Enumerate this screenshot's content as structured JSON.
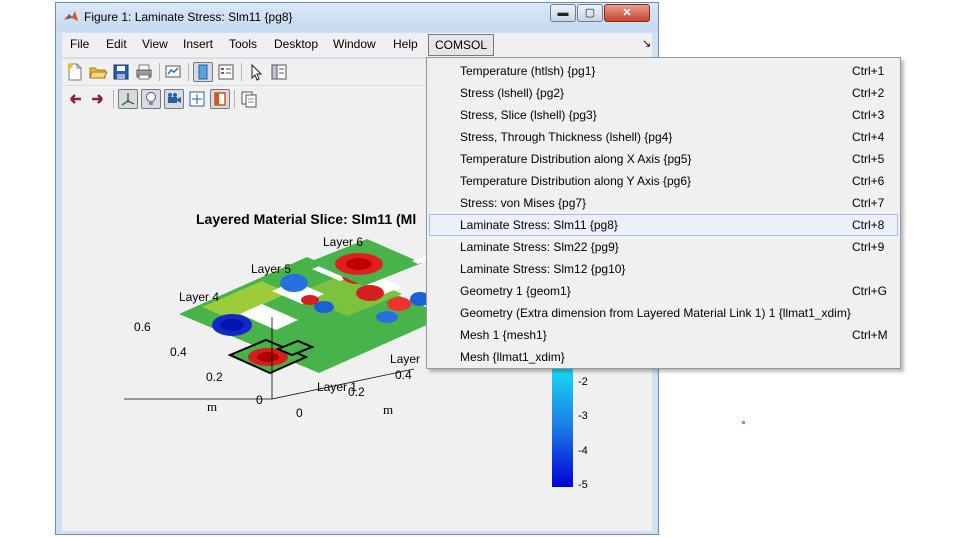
{
  "window": {
    "title": "Figure 1: Laminate Stress: Slm11 {pg8}",
    "controls": {
      "minimize": "▬",
      "maximize": "▢",
      "close": "✕"
    }
  },
  "menubar": {
    "items": [
      "File",
      "Edit",
      "View",
      "Insert",
      "Tools",
      "Desktop",
      "Window",
      "Help"
    ],
    "active": "COMSOL",
    "dock_icon": "↘"
  },
  "toolbar": {
    "row1_icons": [
      "new-figure-icon",
      "open-file-icon",
      "save-icon",
      "print-icon",
      "link-plot-icon",
      "dock-figure-icon",
      "insert-legend-icon",
      "pointer-icon",
      "property-editor-icon"
    ],
    "row2_icons": [
      "back-arrow-icon",
      "forward-arrow-icon",
      "axes-icon",
      "light-icon",
      "camera-icon",
      "zoom-fit-icon",
      "box-icon",
      "copy-icon"
    ]
  },
  "plot": {
    "title": "Layered Material Slice: Slm11 (Ml",
    "layer_labels": [
      "Layer 6",
      "Layer 5",
      "Layer 4",
      "Layer",
      "Layer 1"
    ],
    "y_ticks": [
      "0.6",
      "0.4",
      "0.2",
      "0"
    ],
    "x_ticks": [
      "0",
      "0.2",
      "0.4"
    ],
    "x_axis_label": "m",
    "y_axis_label": "m",
    "colorbar_ticks": [
      "-2",
      "-3",
      "-4",
      "-5"
    ]
  },
  "dropdown": {
    "items": [
      {
        "label": "Temperature (htlsh) {pg1}",
        "accel": "Ctrl+1"
      },
      {
        "label": "Stress (lshell) {pg2}",
        "accel": "Ctrl+2"
      },
      {
        "label": "Stress, Slice (lshell) {pg3}",
        "accel": "Ctrl+3"
      },
      {
        "label": "Stress, Through Thickness (lshell) {pg4}",
        "accel": "Ctrl+4"
      },
      {
        "label": "Temperature Distribution along X Axis {pg5}",
        "accel": "Ctrl+5"
      },
      {
        "label": "Temperature Distribution along Y Axis {pg6}",
        "accel": "Ctrl+6"
      },
      {
        "label": "Stress: von Mises {pg7}",
        "accel": "Ctrl+7"
      },
      {
        "label": "Laminate Stress: Slm11 {pg8}",
        "accel": "Ctrl+8"
      },
      {
        "label": "Laminate Stress: Slm22 {pg9}",
        "accel": "Ctrl+9"
      },
      {
        "label": "Laminate Stress: Slm12 {pg10}",
        "accel": ""
      },
      {
        "label": "Geometry 1 {geom1}",
        "accel": "Ctrl+G"
      },
      {
        "label": "Geometry (Extra dimension from Layered Material Link 1) 1 {llmat1_xdim}",
        "accel": ""
      },
      {
        "label": "Mesh 1 {mesh1}",
        "accel": "Ctrl+M"
      },
      {
        "label": "Mesh {llmat1_xdim}",
        "accel": ""
      }
    ],
    "highlighted_index": 7,
    "highlight_color": "#eaf1fb"
  }
}
